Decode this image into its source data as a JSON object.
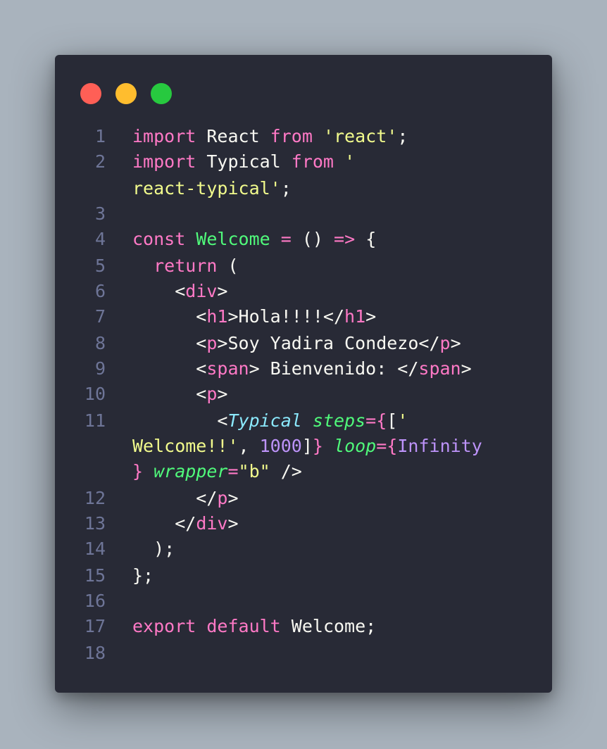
{
  "window": {
    "controls": {
      "close_color": "#ff5f56",
      "minimize_color": "#ffbd2e",
      "maximize_color": "#27c93f"
    }
  },
  "colors": {
    "background": "#a9b3bd",
    "editor": "#282a36",
    "keyword": "#ff79c6",
    "string": "#f1fa8c",
    "function": "#50fa7b",
    "component": "#8be9fd",
    "number": "#bd93f9",
    "line_number": "#6e7597"
  },
  "code": {
    "line_numbers": [
      "1",
      "2",
      "3",
      "4",
      "5",
      "6",
      "7",
      "8",
      "9",
      "10",
      "11",
      "12",
      "13",
      "14",
      "15",
      "16",
      "17",
      "18"
    ],
    "l1": {
      "a": "import",
      "b": " React ",
      "c": "from",
      "d": " ",
      "e": "'react'",
      "f": ";"
    },
    "l2": {
      "a": "import",
      "b": " Typical ",
      "c": "from",
      "d": " ",
      "e": "'"
    },
    "l2b": {
      "a": "react-typical'",
      "b": ";"
    },
    "l4": {
      "a": "const",
      "b": " ",
      "c": "Welcome",
      "d": " ",
      "e": "=",
      "f": " () ",
      "g": "=>",
      "h": " {"
    },
    "l5": {
      "a": "  ",
      "b": "return",
      "c": " ("
    },
    "l6": {
      "a": "    <",
      "b": "div",
      "c": ">"
    },
    "l7": {
      "a": "      <",
      "b": "h1",
      "c": ">Hola!!!!</",
      "d": "h1",
      "e": ">"
    },
    "l8": {
      "a": "      <",
      "b": "p",
      "c": ">Soy Yadira Condezo</",
      "d": "p",
      "e": ">"
    },
    "l9": {
      "a": "      <",
      "b": "span",
      "c": "> Bienvenido: </",
      "d": "span",
      "e": ">"
    },
    "l10": {
      "a": "      <",
      "b": "p",
      "c": ">"
    },
    "l11": {
      "a": "        <",
      "b": "Typical",
      "c": " ",
      "d": "steps",
      "e": "={",
      "f": "[",
      "g": "'"
    },
    "l11b": {
      "a": "Welcome!!'",
      "b": ", ",
      "c": "1000",
      "d": "]",
      "e": "}",
      "f": " ",
      "g": "loop",
      "h": "={",
      "i": "Infinity"
    },
    "l11c": {
      "a": "}",
      "b": " ",
      "c": "wrapper",
      "d": "=",
      "e": "\"b\"",
      "f": " />"
    },
    "l12": {
      "a": "      </",
      "b": "p",
      "c": ">"
    },
    "l13": {
      "a": "    </",
      "b": "div",
      "c": ">"
    },
    "l14": {
      "a": "  );"
    },
    "l15": {
      "a": "};"
    },
    "l17": {
      "a": "export",
      "b": " ",
      "c": "default",
      "d": " Welcome;"
    }
  }
}
